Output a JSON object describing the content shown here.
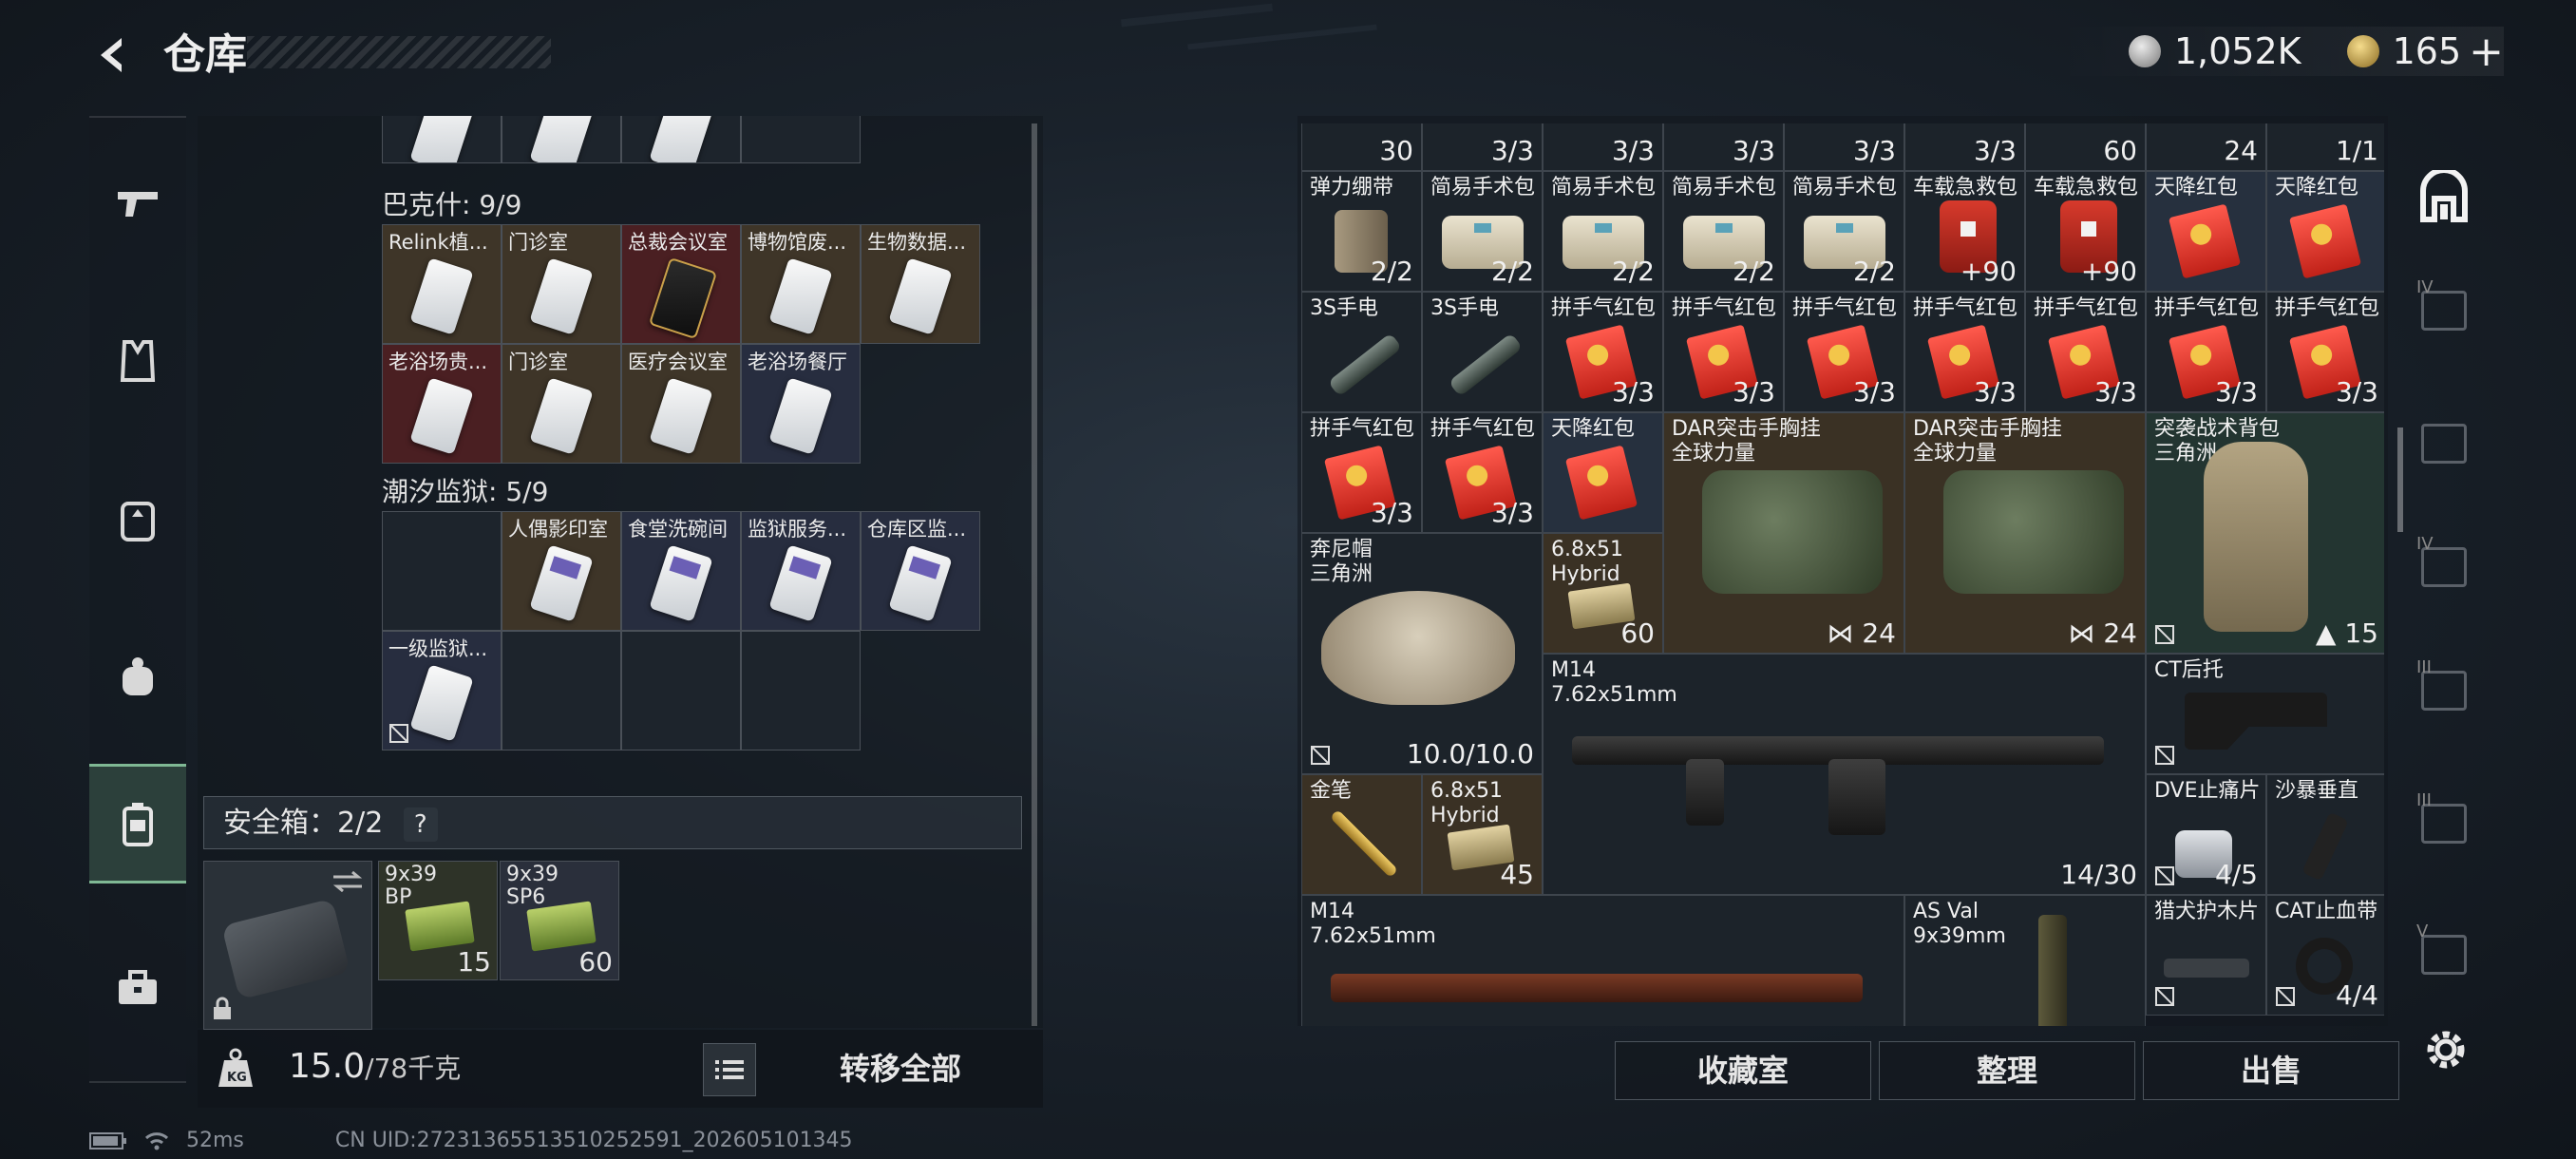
{
  "header": {
    "title": "仓库",
    "currency": {
      "silver": "1,052K",
      "gold": "165",
      "gold_plus": "+"
    }
  },
  "left_nav": {
    "items": [
      {
        "icon": "gun-icon"
      },
      {
        "icon": "vest-icon"
      },
      {
        "icon": "backpack-icon"
      },
      {
        "icon": "pouch-icon"
      },
      {
        "icon": "container-icon",
        "active": true
      },
      {
        "icon": "toolbox-icon"
      }
    ]
  },
  "warehouse": {
    "sections": [
      {
        "title": "巴克什: 9/9",
        "items": [
          "Relink植...",
          "门诊室",
          "总裁会议室",
          "博物馆废...",
          "生物数据...",
          "老浴场贵...",
          "门诊室",
          "医疗会议室",
          "老浴场餐厅"
        ]
      },
      {
        "title": "潮汐监狱: 5/9",
        "items": [
          "人偶影印室",
          "食堂洗碗间",
          "监狱服务...",
          "仓库区监...",
          "一级监狱..."
        ]
      }
    ],
    "safe": {
      "label": "安全箱：2/2",
      "help": "?",
      "ammo": [
        {
          "name": "9x39\nBP",
          "count": "15"
        },
        {
          "name": "9x39\nSP6",
          "count": "60"
        }
      ]
    },
    "weight": {
      "current": "15.0",
      "max": "/78千克"
    },
    "transfer_all": "转移全部"
  },
  "inventory": {
    "top_counts": [
      "30",
      "3/3",
      "3/3",
      "3/3",
      "3/3",
      "3/3",
      "60",
      "24",
      "1/1"
    ],
    "row1": [
      {
        "name": "弹力绷带",
        "count": "2/2"
      },
      {
        "name": "简易手术包",
        "count": "2/2"
      },
      {
        "name": "简易手术包",
        "count": "2/2"
      },
      {
        "name": "简易手术包",
        "count": "2/2"
      },
      {
        "name": "简易手术包",
        "count": "2/2"
      },
      {
        "name": "车载急救包",
        "count": "+90"
      },
      {
        "name": "车载急救包",
        "count": "+90"
      },
      {
        "name": "天降红包",
        "count": ""
      },
      {
        "name": "天降红包",
        "count": ""
      }
    ],
    "row2": [
      {
        "name": "3S手电",
        "count": ""
      },
      {
        "name": "3S手电",
        "count": ""
      },
      {
        "name": "拼手气红包",
        "count": "3/3"
      },
      {
        "name": "拼手气红包",
        "count": "3/3"
      },
      {
        "name": "拼手气红包",
        "count": "3/3"
      },
      {
        "name": "拼手气红包",
        "count": "3/3"
      },
      {
        "name": "拼手气红包",
        "count": "3/3"
      },
      {
        "name": "拼手气红包",
        "count": "3/3"
      },
      {
        "name": "拼手气红包",
        "count": "3/3"
      }
    ],
    "row3": [
      {
        "name": "拼手气红包",
        "count": "3/3"
      },
      {
        "name": "拼手气红包",
        "count": "3/3"
      },
      {
        "name": "天降红包",
        "count": ""
      }
    ],
    "bag1": {
      "name": "DAR突击手胸挂\n全球力量",
      "count": "24"
    },
    "bag2": {
      "name": "DAR突击手胸挂\n全球力量",
      "count": "24"
    },
    "backpack": {
      "name": "突袭战术背包\n三角洲",
      "count": "15"
    },
    "hat": {
      "name": "奔尼帽\n三角洲",
      "count": "10.0/10.0"
    },
    "ammo68a": {
      "name": "6.8x51\nHybrid",
      "count": "60"
    },
    "m14a": {
      "name": "M14\n7.62x51mm",
      "count": "14/30"
    },
    "stock": {
      "name": "CT后托",
      "count": ""
    },
    "pen": {
      "name": "金笔",
      "count": ""
    },
    "ammo68b": {
      "name": "6.8x51\nHybrid",
      "count": "45"
    },
    "suppressor": {
      "name": "DVE止痛片",
      "count": "4/5"
    },
    "vgrip": {
      "name": "沙暴垂直",
      "count": ""
    },
    "m14b": {
      "name": "M14\n7.62x51mm",
      "count": ""
    },
    "asval": {
      "name": "AS Val\n9x39mm",
      "count": ""
    },
    "handguard": {
      "name": "猎犬护木片",
      "count": ""
    },
    "tourniquet": {
      "name": "CAT止血带",
      "count": "4/4"
    }
  },
  "actions": {
    "collection": "收藏室",
    "sort": "整理",
    "sell": "出售"
  },
  "right_nav": {
    "tiers": [
      "",
      "IV",
      "",
      "IV",
      "III",
      "III",
      "V"
    ]
  },
  "status": {
    "ping": "52ms",
    "uid": "CN UID:27231365513510252591_202605101345"
  }
}
